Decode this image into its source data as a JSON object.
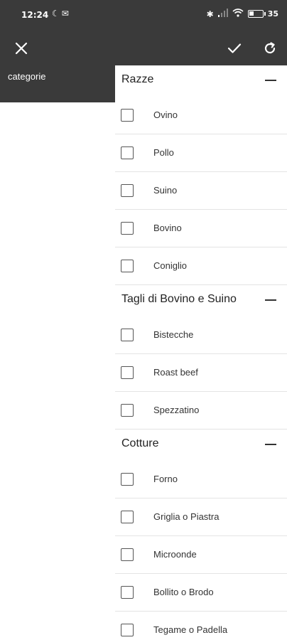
{
  "status_bar": {
    "time": "12:24",
    "left_icons": [
      "moon-icon",
      "mail-icon"
    ],
    "right_icons": [
      "bluetooth-icon",
      "signal-icon",
      "wifi-icon",
      "battery-icon"
    ],
    "battery_level": 0.35,
    "battery_text": "35"
  },
  "app_bar": {
    "icons": [
      "close-icon",
      "check-icon",
      "refresh-icon"
    ]
  },
  "left_panel": {
    "label": "categorie"
  },
  "sections": [
    {
      "title": "Razze",
      "items": [
        "Ovino",
        "Pollo",
        "Suino",
        "Bovino",
        "Coniglio"
      ]
    },
    {
      "title": "Tagli di Bovino e Suino",
      "items": [
        "Bistecche",
        "Roast beef",
        "Spezzatino"
      ]
    },
    {
      "title": "Cotture",
      "items": [
        "Forno",
        "Griglia o Piastra",
        "Microonde",
        "Bollito o Brodo",
        "Tegame o Padella"
      ]
    }
  ]
}
